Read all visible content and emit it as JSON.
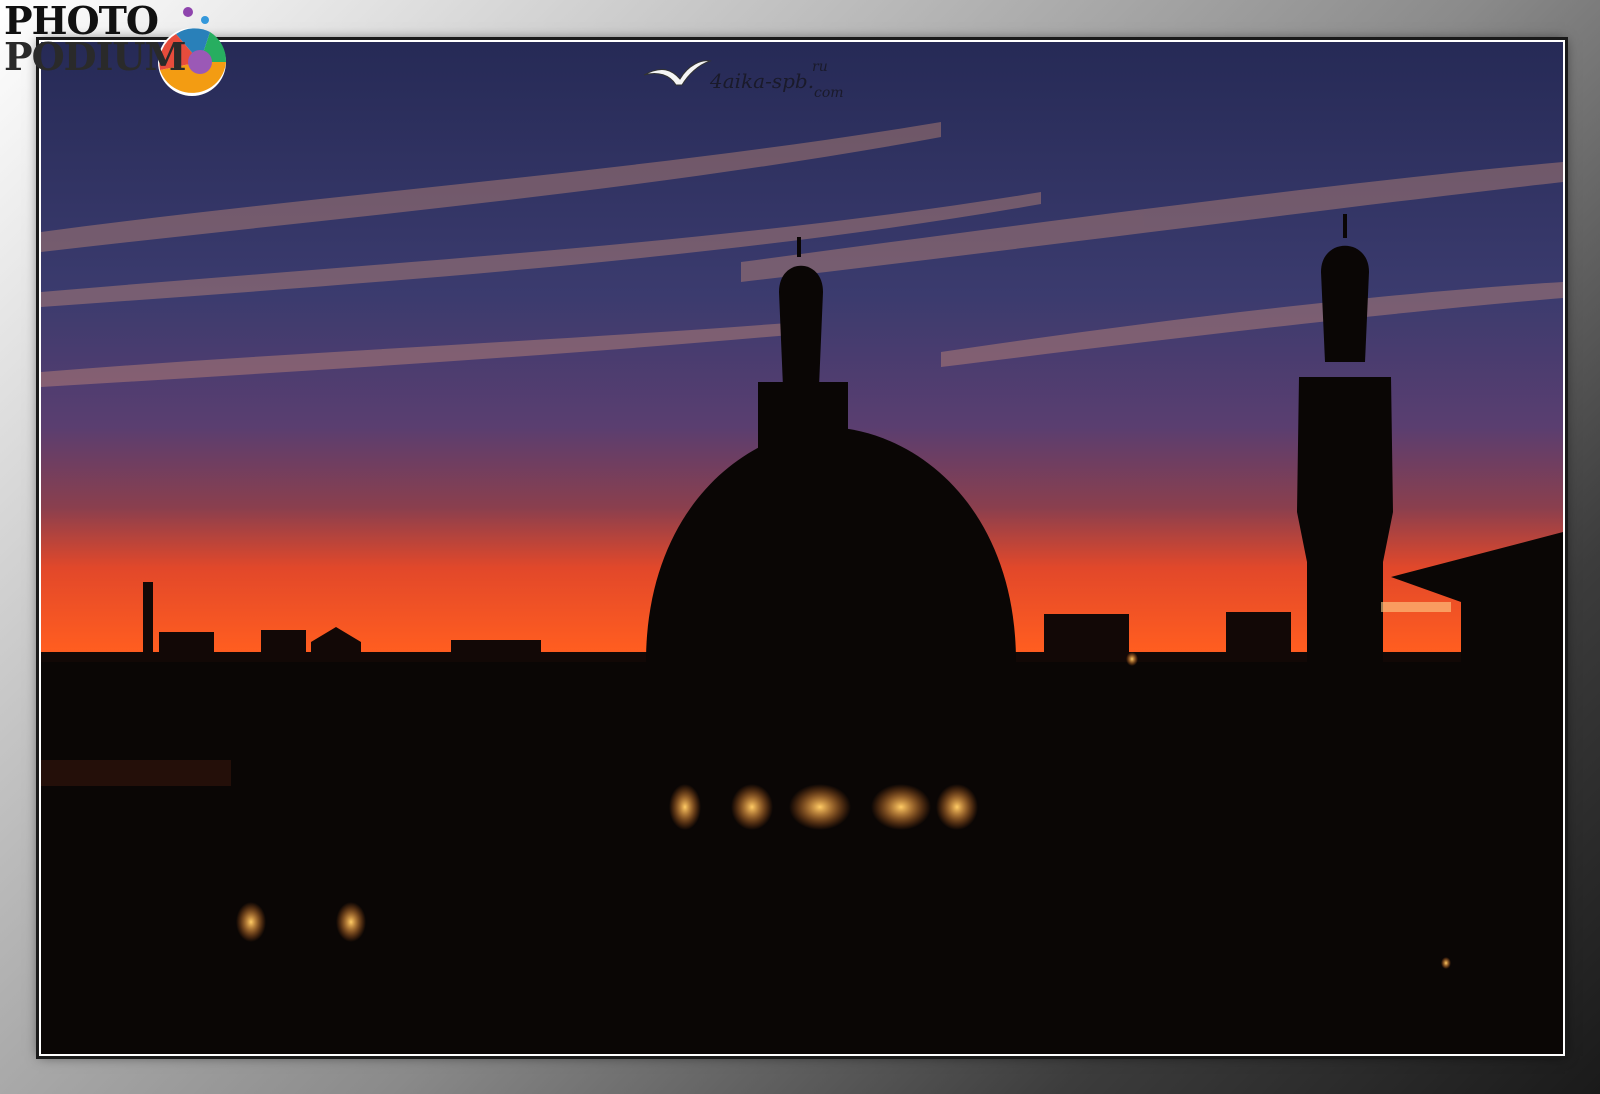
{
  "logo": {
    "line1": "PHOTO",
    "line2": "PODIUM"
  },
  "watermark": {
    "main": "4aika-spb.",
    "ru": "ru",
    "com": "com"
  },
  "colors": {
    "sky_top": "#2a2f5c",
    "sky_mid": "#5a3a6a",
    "sunset_band": "#ff5a1e",
    "silhouette": "#0a0605",
    "window_glow": "#ffb347"
  }
}
